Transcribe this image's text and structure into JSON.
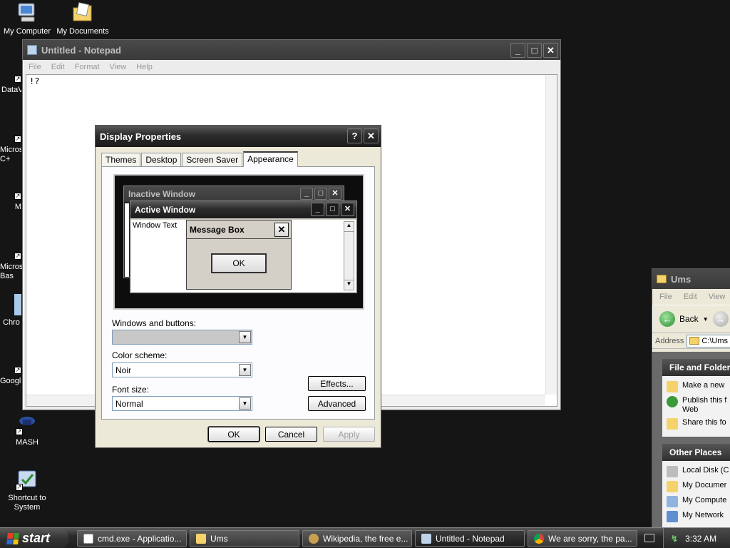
{
  "desktop": {
    "icons": [
      {
        "label": "My Computer"
      },
      {
        "label": "My Documents"
      },
      {
        "label": "DataV"
      },
      {
        "label": "Micros\nC+"
      },
      {
        "label": "M"
      },
      {
        "label": "Micros\nBas"
      },
      {
        "label": "Chro"
      },
      {
        "label": "Googl"
      },
      {
        "label": "MASH"
      },
      {
        "label": "Shortcut to\nSystem"
      }
    ]
  },
  "notepad": {
    "title": "Untitled - Notepad",
    "menu": [
      "File",
      "Edit",
      "Format",
      "View",
      "Help"
    ],
    "content": "!?"
  },
  "display_properties": {
    "title": "Display Properties",
    "tabs": [
      "Themes",
      "Desktop",
      "Screen Saver",
      "Appearance"
    ],
    "active_tab": "Appearance",
    "preview": {
      "inactive_title": "Inactive Window",
      "active_title": "Active Window",
      "window_text": "Window Text",
      "message_title": "Message Box",
      "message_ok": "OK"
    },
    "windows_buttons_label": "Windows and buttons:",
    "windows_buttons_value": "",
    "color_scheme_label": "Color scheme:",
    "color_scheme_value": "Noir",
    "font_size_label": "Font size:",
    "font_size_value": "Normal",
    "effects_label": "Effects...",
    "advanced_label": "Advanced",
    "ok_label": "OK",
    "cancel_label": "Cancel",
    "apply_label": "Apply"
  },
  "ums": {
    "title": "Ums",
    "menu": [
      "File",
      "Edit",
      "View"
    ],
    "back_label": "Back",
    "address_label": "Address",
    "address_value": "C:\\Ums",
    "file_folder_header": "File and Folder",
    "file_tasks": [
      "Make a new",
      "Publish this f\nWeb",
      "Share this fo"
    ],
    "other_places_header": "Other Places",
    "places": [
      "Local Disk (C",
      "My Documer",
      "My Compute",
      "My Network"
    ]
  },
  "taskbar": {
    "start_label": "start",
    "buttons": [
      "cmd.exe - Applicatio...",
      "Ums",
      "Wikipedia, the free e...",
      "Untitled - Notepad",
      "We are sorry, the pa..."
    ],
    "clock": "3:32 AM"
  },
  "colors": {
    "desktop_bg": "#151515",
    "titlebar_dark": "#1c1c1c",
    "dialog_face": "#ece9d8"
  }
}
